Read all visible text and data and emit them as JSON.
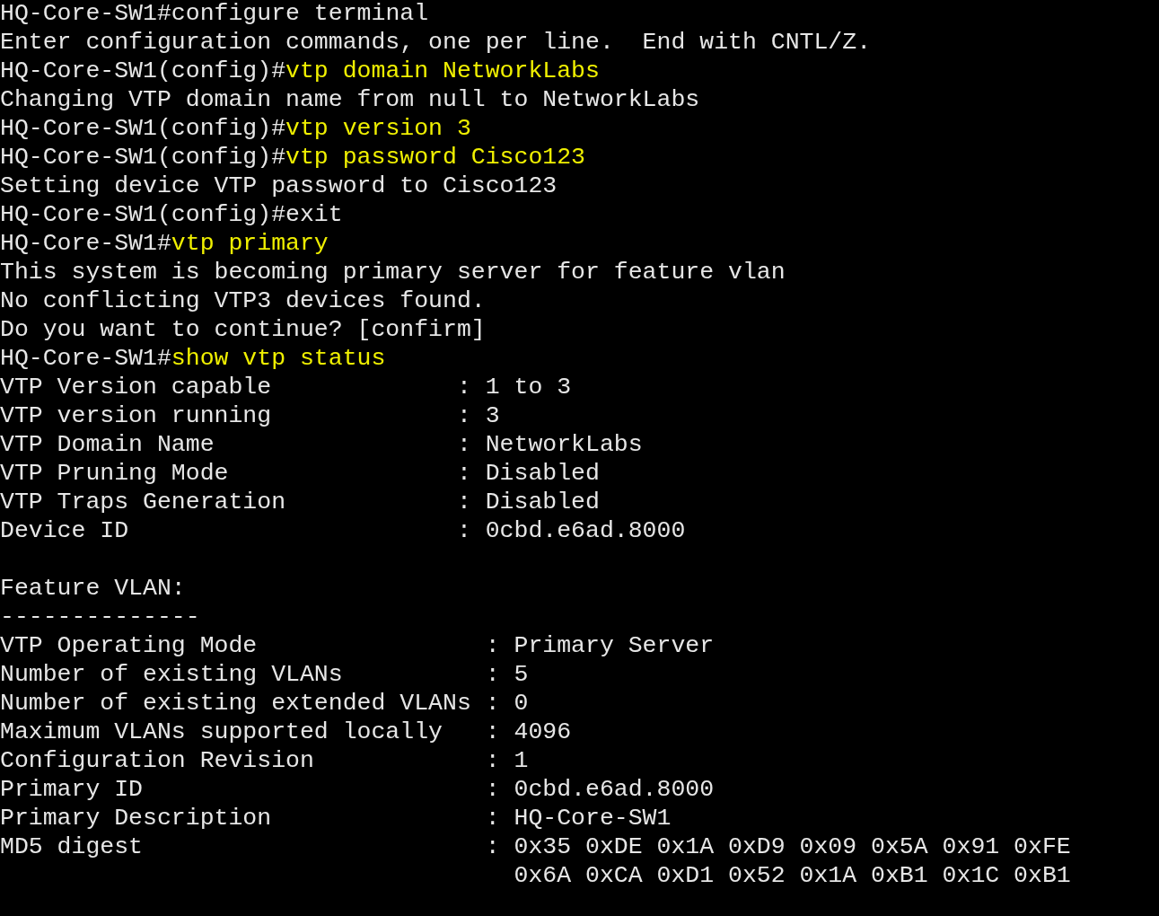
{
  "terminal": {
    "lines": [
      {
        "kind": "prompt",
        "prompt": "HQ-Core-SW1#",
        "command": "configure terminal",
        "highlighted": false
      },
      {
        "kind": "output",
        "text": "Enter configuration commands, one per line.  End with CNTL/Z."
      },
      {
        "kind": "prompt",
        "prompt": "HQ-Core-SW1(config)#",
        "command": "vtp domain NetworkLabs",
        "highlighted": true
      },
      {
        "kind": "output",
        "text": "Changing VTP domain name from null to NetworkLabs"
      },
      {
        "kind": "prompt",
        "prompt": "HQ-Core-SW1(config)#",
        "command": "vtp version 3",
        "highlighted": true
      },
      {
        "kind": "prompt",
        "prompt": "HQ-Core-SW1(config)#",
        "command": "vtp password Cisco123",
        "highlighted": true
      },
      {
        "kind": "output",
        "text": "Setting device VTP password to Cisco123"
      },
      {
        "kind": "prompt",
        "prompt": "HQ-Core-SW1(config)#",
        "command": "exit",
        "highlighted": false
      },
      {
        "kind": "prompt",
        "prompt": "HQ-Core-SW1#",
        "command": "vtp primary",
        "highlighted": true
      },
      {
        "kind": "output",
        "text": "This system is becoming primary server for feature vlan"
      },
      {
        "kind": "output",
        "text": "No conflicting VTP3 devices found."
      },
      {
        "kind": "output",
        "text": "Do you want to continue? [confirm]"
      },
      {
        "kind": "prompt",
        "prompt": "HQ-Core-SW1#",
        "command": "show vtp status",
        "highlighted": true
      },
      {
        "kind": "output",
        "text": "VTP Version capable             : 1 to 3"
      },
      {
        "kind": "output",
        "text": "VTP version running             : 3"
      },
      {
        "kind": "output",
        "text": "VTP Domain Name                 : NetworkLabs"
      },
      {
        "kind": "output",
        "text": "VTP Pruning Mode                : Disabled"
      },
      {
        "kind": "output",
        "text": "VTP Traps Generation            : Disabled"
      },
      {
        "kind": "output",
        "text": "Device ID                       : 0cbd.e6ad.8000"
      },
      {
        "kind": "blank"
      },
      {
        "kind": "output",
        "text": "Feature VLAN:"
      },
      {
        "kind": "output",
        "text": "--------------"
      },
      {
        "kind": "output",
        "text": "VTP Operating Mode                : Primary Server"
      },
      {
        "kind": "output",
        "text": "Number of existing VLANs          : 5"
      },
      {
        "kind": "output",
        "text": "Number of existing extended VLANs : 0"
      },
      {
        "kind": "output",
        "text": "Maximum VLANs supported locally   : 4096"
      },
      {
        "kind": "output",
        "text": "Configuration Revision            : 1"
      },
      {
        "kind": "output",
        "text": "Primary ID                        : 0cbd.e6ad.8000"
      },
      {
        "kind": "output",
        "text": "Primary Description               : HQ-Core-SW1"
      },
      {
        "kind": "output",
        "text": "MD5 digest                        : 0x35 0xDE 0x1A 0xD9 0x09 0x5A 0x91 0xFE"
      },
      {
        "kind": "output",
        "text": "                                    0x6A 0xCA 0xD1 0x52 0x1A 0xB1 0x1C 0xB1"
      }
    ]
  }
}
